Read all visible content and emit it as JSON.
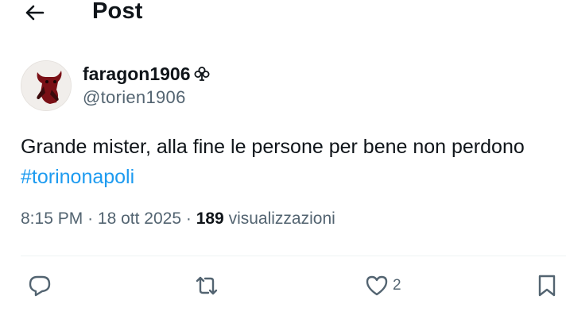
{
  "header": {
    "title": "Post"
  },
  "post": {
    "author": {
      "display_name": "faragon1906",
      "handle": "@torien1906"
    },
    "text": "Grande mister, alla fine le persone per bene non perdono",
    "hashtag": "#torinonapoli",
    "time": "8:15 PM",
    "separator": "·",
    "date": "18 ott 2025",
    "views_count": "189",
    "views_label": "visualizzazioni"
  },
  "actions": {
    "reply_icon": "speech-bubble-icon",
    "repost_icon": "repost-arrows-icon",
    "like_icon": "heart-icon",
    "like_count": "2",
    "bookmark_icon": "bookmark-icon"
  },
  "colors": {
    "link": "#1d9bf0",
    "secondary_text": "#536471",
    "primary_text": "#0f1419"
  }
}
